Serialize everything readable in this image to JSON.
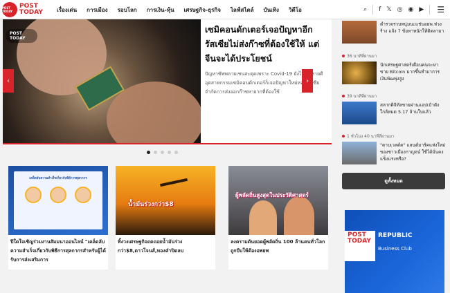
{
  "logo": {
    "badge": "POST TODAY",
    "line1": "POST",
    "line2": "TODAY"
  },
  "nav": [
    "เรื่องเด่น",
    "การเมือง",
    "รอบโลก",
    "การเงิน-หุ้น",
    "เศรษฐกิจ-ธุรกิจ",
    "ไลฟ์สไตล์",
    "บันเทิง",
    "วิดีโอ"
  ],
  "tools": {
    "search": "⌕",
    "facebook": "f",
    "twitter": "𝕏",
    "instagram": "◎",
    "line": "◉",
    "youtube": "▶",
    "menu": "☰"
  },
  "hero": {
    "badge": "POST TODAY",
    "title": "เซมิคอนดักเตอร์เจอปัญหาอีก รัสเซียไม่ส่งก๊าซที่ต้องใช้ให้ แต่จีนจะได้ประโยชน์",
    "desc": "ปัญหาซัพพลายเชนสะดุดเพราะ Covid-19 ยังไม่ทันหายดี อุตสาหกรรมเซมิคอนดักเตอร์ก็เจอปัญหาใหม่หลังรัสเซียจำกัดการส่งออกก๊าซหายากที่ต้องใช้",
    "prev": "‹",
    "next": "›"
  },
  "cards": [
    {
      "title": "ปีใดใจเชิญร่วมงานสัมมนาออนไลน์ \"เคล็ดลับความสำเร็จเกี่ยวกับพิธีการศุลกากรสำหรับผู้ได้รับการส่งเสริมการ",
      "image_title": "เคล็ดลับความสำเร็จเกี่ยวกับพิธีการศุลกากร"
    },
    {
      "title": "ทิ้งวงเศรษฐกิจถดถอยน้ำมันร่วงกว่า$8,ดาวโจนส์,ทองคำปิดลบ",
      "image_headline": "น้ำมันร่วงกว่า$8"
    },
    {
      "title": "ลงครามดันยอดผู้พลัดถิ่น 100 ล้านคนทั่วโลกถูกบีบให้ต้องอพยพ",
      "image_headline": "ผู้พลัดถิ่นสูงสุดในประวัติศาสตร์"
    }
  ],
  "sidebar": {
    "items": [
      {
        "time": "",
        "title": "ตำรวจรวบหนุ่มนะแช่บอยพ.ห่วงร้าง แจ้ง 7 ข้อหาหนักให้ติดลามา"
      },
      {
        "time": "36 นาทีที่ผ่านมา",
        "title": "นักเศรษฐศาสตร์เตือนคนจะหาขาย Bitcoin มากขึ้นทำมาการเงินพัฒพุ่งสูง"
      },
      {
        "time": "39 นาทีที่ผ่านมา",
        "title": "สลากดิจิทัลขายผ่านแอปเป๋าตังใกล้หมด 5.17 ล้านใบแล้ว"
      },
      {
        "time": "1 ชั่วโมง 40 นาทีที่ผ่านมา",
        "title": "\"ดาบเวลด์ด\" แลนด์มาร์คแห่งใหม่ของชาวเมืองกาญจน์ ใช้ได้มั่นคงแข็งแรงหรือ?"
      }
    ],
    "more_label": "ดูทั้งหมด",
    "ad": {
      "post": "POST",
      "today": "TODAY",
      "republic": "REPUBLIC",
      "club": "Business Club"
    }
  },
  "colors": {
    "brand": "#d8232a",
    "button": "#3b3b3b"
  }
}
